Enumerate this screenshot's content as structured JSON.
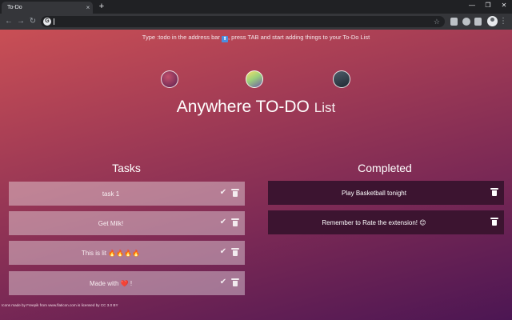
{
  "browser": {
    "tab_title": "To-Do",
    "tab_close": "×",
    "new_tab": "+",
    "window_controls": [
      "—",
      "❐",
      "✕"
    ],
    "nav": {
      "back": "←",
      "forward": "→",
      "reload": "↻"
    },
    "omnibox_icon": "G",
    "star": "☆",
    "extensions": [
      "extension-icon-1",
      "puzzle-icon",
      "extension-icon-2"
    ],
    "menu": "⋮"
  },
  "page": {
    "hint_text_before": "Type :todo in the address bar ",
    "hint_badge": "⬆",
    "hint_text_after": ", press TAB and start adding things to your To-Do List",
    "themes": [
      "theme-red",
      "theme-multicolor",
      "theme-dark"
    ],
    "title_main": "Anywhere TO-DO",
    "title_sub": "List",
    "tasks_heading": "Tasks",
    "completed_heading": "Completed",
    "tasks": [
      {
        "text": "task 1"
      },
      {
        "text": "Get Milk!"
      },
      {
        "text": "This is lit 🔥🔥🔥🔥"
      },
      {
        "text": "Made with ❤️ !"
      }
    ],
    "completed": [
      {
        "text": "Play Basketball tonight"
      },
      {
        "text": "Remember to Rate the extension! 😊"
      }
    ],
    "check_icon": "✔",
    "credits": "Icons made by Freepik from www.flaticon.com is licensed by CC 3.0 BY"
  },
  "colors": {
    "gradient_top": "#c94f55",
    "gradient_bottom": "#4c1653",
    "completed_card": "#3c1430",
    "hint_badge": "#4a8ee0"
  }
}
